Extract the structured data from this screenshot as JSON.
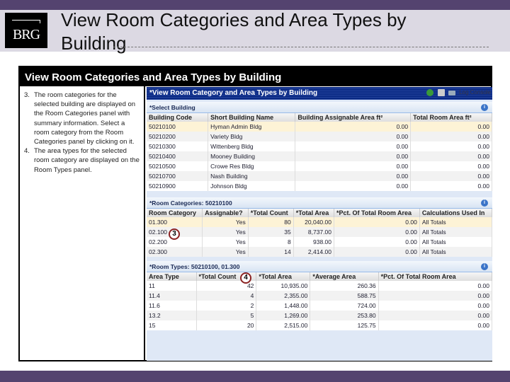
{
  "slide": {
    "title": "View Room Categories and Area Types by Building",
    "logo": "BRG",
    "frame_title": "View Room Categories and Area Types by Building",
    "steps": [
      {
        "num": "3.",
        "text": "The room categories for the selected building are displayed on the Room Categories panel with summary information. Select a room category from the Room Categories panel by clicking on it."
      },
      {
        "num": "4.",
        "text": "The area types for the selected room category are displayed on the Room Types panel."
      }
    ]
  },
  "app": {
    "title": "*View Room Category and Area Types by Building",
    "log_console": "Log Console",
    "buildings": {
      "header": "*Select Building",
      "columns": [
        "Building Code",
        "Short Building Name",
        "Building Assignable Area ft²",
        "Total Room Area ft²"
      ],
      "rows": [
        [
          "50210100",
          "Hyman Admin Bldg",
          "0.00",
          "0.00"
        ],
        [
          "50210200",
          "Variety Bldg",
          "0.00",
          "0.00"
        ],
        [
          "50210300",
          "Wittenberg Bldg",
          "0.00",
          "0.00"
        ],
        [
          "50210400",
          "Mooney Building",
          "0.00",
          "0.00"
        ],
        [
          "50210500",
          "Crowe Res Bldg",
          "0.00",
          "0.00"
        ],
        [
          "50210700",
          "Nash Building",
          "0.00",
          "0.00"
        ],
        [
          "50210900",
          "Johnson Bldg",
          "0.00",
          "0.00"
        ]
      ]
    },
    "categories": {
      "header": "*Room Categories: 50210100",
      "columns": [
        "Room Category",
        "Assignable?",
        "*Total Count",
        "*Total Area",
        "*Pct. Of Total Room Area",
        "Calculations Used In"
      ],
      "rows": [
        [
          "01.300",
          "Yes",
          "80",
          "20,040.00",
          "0.00",
          "All Totals"
        ],
        [
          "02.100",
          "Yes",
          "35",
          "8,737.00",
          "0.00",
          "All Totals"
        ],
        [
          "02.200",
          "Yes",
          "8",
          "938.00",
          "0.00",
          "All Totals"
        ],
        [
          "02.300",
          "Yes",
          "14",
          "2,414.00",
          "0.00",
          "All Totals"
        ]
      ]
    },
    "types": {
      "header": "*Room Types: 50210100, 01.300",
      "columns": [
        "Area Type",
        "*Total Count",
        "*Total Area",
        "*Average Area",
        "*Pct. Of Total Room Area"
      ],
      "rows": [
        [
          "11",
          "42",
          "10,935.00",
          "260.36",
          "0.00"
        ],
        [
          "11.4",
          "4",
          "2,355.00",
          "588.75",
          "0.00"
        ],
        [
          "11.6",
          "2",
          "1,448.00",
          "724.00",
          "0.00"
        ],
        [
          "13.2",
          "5",
          "1,269.00",
          "253.80",
          "0.00"
        ],
        [
          "15",
          "20",
          "2,515.00",
          "125.75",
          "0.00"
        ]
      ]
    },
    "callouts": [
      "3",
      "4"
    ]
  }
}
